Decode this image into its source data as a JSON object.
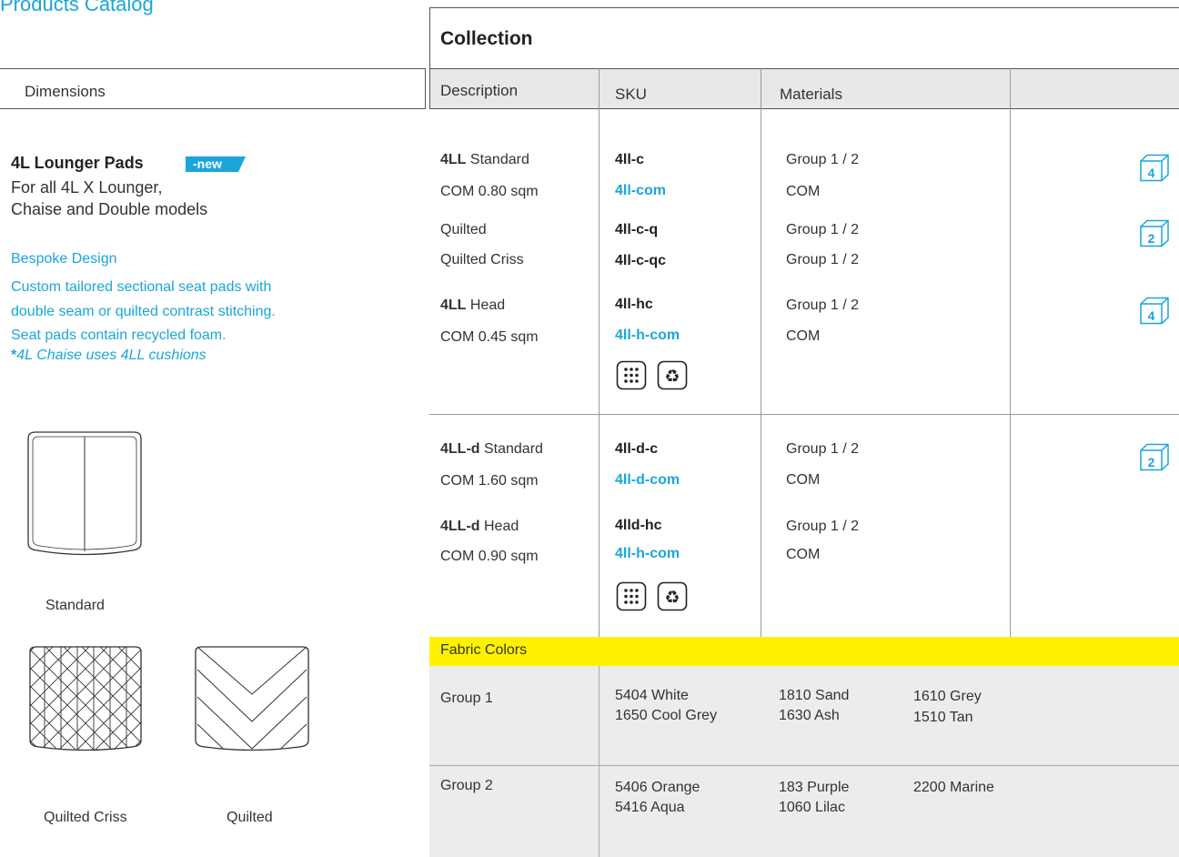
{
  "header": {
    "title": "Products Catalog"
  },
  "left": {
    "dimensions_label": "Dimensions",
    "product_title": "4L Lounger Pads",
    "new_badge": "-new",
    "product_subtitle_1": "For all 4L X Lounger,",
    "product_subtitle_2": "Chaise and Double models",
    "bespoke_title": "Bespoke Design",
    "bespoke_line_1": "Custom tailored sectional seat pads with",
    "bespoke_line_2": "double seam or quilted contrast stitching.",
    "bespoke_line_3": "Seat pads contain recycled foam.",
    "note_star": "*",
    "note_text": "4L Chaise uses 4LL cushions",
    "images": [
      {
        "caption": "Standard"
      },
      {
        "caption": "Quilted Criss"
      },
      {
        "caption": "Quilted"
      }
    ]
  },
  "table": {
    "collection_label": "Collection",
    "columns": [
      "Description",
      "SKU",
      "Materials",
      ""
    ],
    "section1": {
      "r1_desc_bold": "4LL",
      "r1_desc": " Standard",
      "r1_sku": "4ll-c",
      "r1_mat": "Group 1 / 2",
      "r2_desc": "COM 0.80 sqm",
      "r2_sku": "4ll-com",
      "r2_mat": "COM",
      "r3_desc": "Quilted",
      "r3_sku": "4ll-c-q",
      "r3_mat": "Group 1 / 2",
      "r4_desc": "Quilted Criss",
      "r4_sku": "4ll-c-qc",
      "r4_mat": "Group 1 / 2",
      "r5_desc_bold": "4LL",
      "r5_desc": " Head",
      "r5_sku": "4ll-hc",
      "r5_mat": "Group 1 / 2",
      "r6_desc": "COM 0.45 sqm",
      "r6_sku": "4ll-h-com",
      "r6_mat": "COM",
      "box_counts": [
        "4",
        "2",
        "4"
      ]
    },
    "section2": {
      "r1_desc_bold": "4LL-d",
      "r1_desc": " Standard",
      "r1_sku": "4ll-d-c",
      "r1_mat": "Group 1 / 2",
      "r2_desc": "COM 1.60 sqm",
      "r2_sku": "4ll-d-com",
      "r2_mat": "COM",
      "r3_desc_bold": "4LL-d",
      "r3_desc": " Head",
      "r3_sku": "4lld-hc",
      "r3_mat": "Group 1 / 2",
      "r4_desc": "COM 0.90 sqm",
      "r4_sku": "4ll-h-com",
      "r4_mat": "COM",
      "box_counts": [
        "2"
      ]
    },
    "fabric": {
      "label": "Fabric Colors",
      "groups": [
        {
          "name": "Group 1",
          "colors": [
            [
              "5404 White",
              "1650 Cool Grey"
            ],
            [
              "1810 Sand",
              "1630 Ash"
            ],
            [
              "1610 Grey",
              "1510 Tan"
            ]
          ]
        },
        {
          "name": "Group 2",
          "colors": [
            [
              "5406 Orange",
              "5416 Aqua"
            ],
            [
              "183 Purple",
              "1060 Lilac"
            ],
            [
              "2200 Marine"
            ]
          ]
        }
      ]
    },
    "icons": [
      "dots-grid-icon",
      "recycle-icon",
      "box-icon"
    ],
    "accent_color": "#1aa6d9",
    "highlight_color": "#fff200"
  }
}
